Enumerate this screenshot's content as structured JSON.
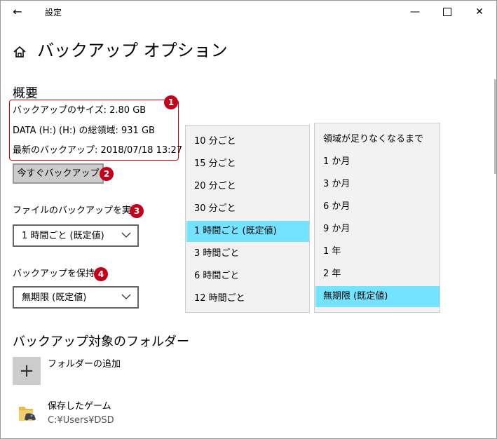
{
  "window": {
    "title": "設定"
  },
  "header": {
    "title": "バックアップ オプション"
  },
  "overview": {
    "heading": "概要",
    "backup_size": "バックアップのサイズ: 2.80 GB",
    "total_space": "DATA (H:) (H:) の総領域: 931 GB",
    "latest_backup": "最新のバックアップ: 2018/07/18 13:27",
    "backup_now_label": "今すぐバックアップ"
  },
  "frequency": {
    "label": "ファイルのバックアップを実行",
    "selected": "1 時間ごと (既定値)",
    "options": [
      "10 分ごと",
      "15 分ごと",
      "20 分ごと",
      "30 分ごと",
      "1 時間ごと (既定値)",
      "3 時間ごと",
      "6 時間ごと",
      "12 時間ごと"
    ],
    "highlighted_index": 4
  },
  "keep": {
    "label": "バックアップを保持",
    "selected": "無期限 (既定値)",
    "options": [
      "領域が足りなくなるまで",
      "1 か月",
      "3 か月",
      "6 か月",
      "9 か月",
      "1 年",
      "2 年",
      "無期限 (既定値)"
    ],
    "highlighted_index": 7
  },
  "folders": {
    "heading": "バックアップ対象のフォルダー",
    "add_label": "フォルダーの追加",
    "items": [
      {
        "name": "保存したゲーム",
        "path": "C:¥Users¥DSD"
      }
    ]
  },
  "badges": [
    "1",
    "2",
    "3",
    "4"
  ],
  "icons": {
    "back": "back-arrow-icon",
    "home": "home-icon",
    "add": "plus-icon",
    "folder": "saved-games-folder-icon",
    "chevron": "chevron-down-icon"
  },
  "colors": {
    "highlight": "#74e3ff",
    "annotation": "#c4001a",
    "annotation_box": "#d80000",
    "button": "#cccccc"
  }
}
